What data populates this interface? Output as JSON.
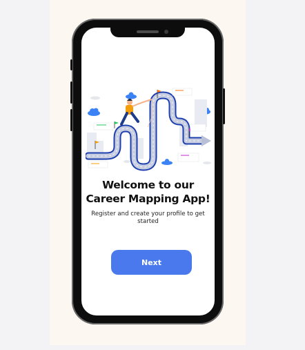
{
  "onboarding": {
    "title": "Welcome to our Career Mapping App!",
    "subtitle": "Register and create your profile to get started",
    "next_label": "Next"
  },
  "colors": {
    "primary": "#4979ec",
    "page_background": "#fdf7f2",
    "phone_frame": "#0d0d0d"
  },
  "icons": [
    "career-road-illustration"
  ]
}
